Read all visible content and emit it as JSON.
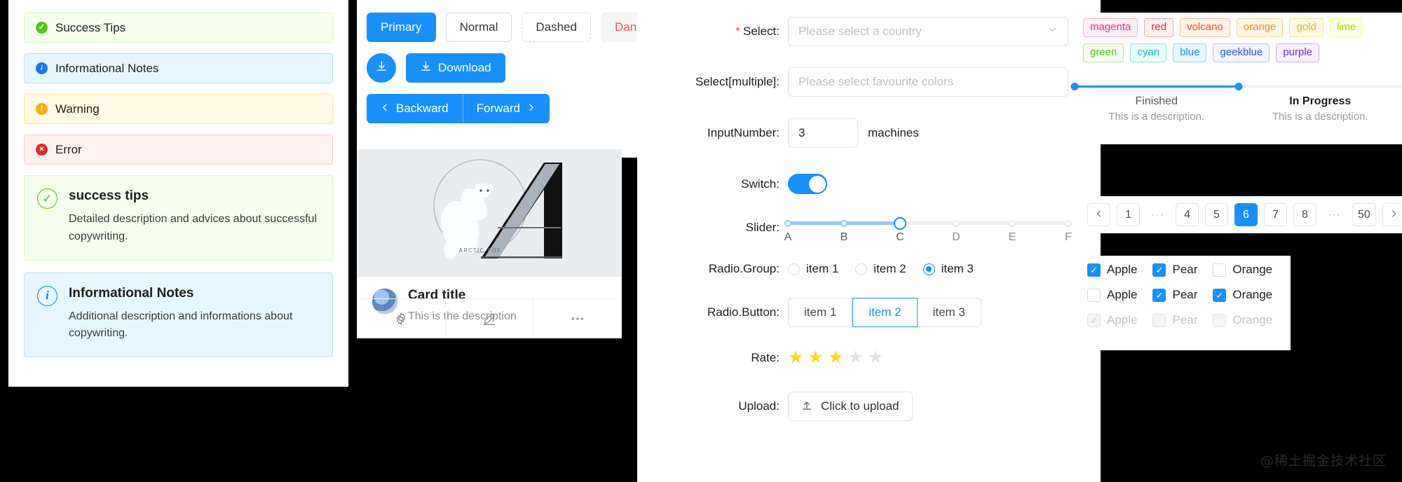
{
  "alerts": {
    "bars": [
      {
        "type": "success",
        "icon": "check-circle-icon",
        "glyph": "✓",
        "text": "Success Tips"
      },
      {
        "type": "info",
        "icon": "info-circle-icon",
        "glyph": "i",
        "text": "Informational Notes"
      },
      {
        "type": "warning",
        "icon": "warning-circle-icon",
        "glyph": "!",
        "text": "Warning"
      },
      {
        "type": "error",
        "icon": "close-circle-icon",
        "glyph": "×",
        "text": "Error"
      }
    ],
    "cards": [
      {
        "type": "success",
        "icon": "check-circle-outline-icon",
        "glyph": "✓",
        "title": "success tips",
        "description": "Detailed description and advices about successful copywriting."
      },
      {
        "type": "info",
        "icon": "info-circle-outline-icon",
        "glyph": "i",
        "title": "Informational Notes",
        "description": "Additional description and informations about copywriting."
      }
    ]
  },
  "buttons": {
    "row1": [
      {
        "label": "Primary",
        "style": "primary"
      },
      {
        "label": "Normal",
        "style": "default"
      },
      {
        "label": "Dashed",
        "style": "dashed"
      },
      {
        "label": "Danger",
        "style": "danger"
      }
    ],
    "download_icon": "download-icon",
    "download_label": "Download",
    "backward_label": "Backward",
    "forward_label": "Forward",
    "backward_icon": "chevron-left-icon",
    "forward_icon": "chevron-right-icon"
  },
  "card": {
    "cover_caption": "ARCTIC FOX",
    "title": "Card title",
    "description": "This is the description",
    "actions": [
      {
        "icon": "gear-icon",
        "glyph": "⚙"
      },
      {
        "icon": "edit-pen-icon",
        "glyph": "✎"
      },
      {
        "icon": "ellipsis-icon",
        "glyph": "⋯"
      }
    ]
  },
  "form": {
    "select": {
      "label": "Select",
      "required_mark": "*",
      "placeholder": "Please select a country",
      "value": "",
      "arrow_icon": "chevron-down-icon"
    },
    "select_multiple": {
      "label": "Select[multiple]",
      "placeholder": "Please select favourite colors",
      "value": ""
    },
    "input_number": {
      "label": "InputNumber",
      "value": "3",
      "unit": "machines"
    },
    "switch": {
      "label": "Switch",
      "checked": true
    },
    "slider": {
      "label": "Slider",
      "marks": [
        "A",
        "B",
        "C",
        "D",
        "E",
        "F"
      ],
      "value": "C",
      "value_index": 2
    },
    "radio_group": {
      "label": "Radio.Group",
      "options": [
        "item 1",
        "item 2",
        "item 3"
      ],
      "selected": "item 3"
    },
    "radio_button": {
      "label": "Radio.Button",
      "options": [
        "item 1",
        "item 2",
        "item 3"
      ],
      "selected": "item 2"
    },
    "rate": {
      "label": "Rate",
      "value": 3,
      "max": 5,
      "glyph": "★"
    },
    "upload": {
      "label": "Upload",
      "button_label": "Click to upload",
      "icon": "upload-icon"
    }
  },
  "tags": {
    "row1": [
      {
        "label": "magenta",
        "color": "#eb2f96",
        "bg": "#fff0f6",
        "border": "#ffadd2"
      },
      {
        "label": "red",
        "color": "#f5222d",
        "bg": "#fff1f0",
        "border": "#ffa39e"
      },
      {
        "label": "volcano",
        "color": "#fa541c",
        "bg": "#fff2e8",
        "border": "#ffbb96"
      },
      {
        "label": "orange",
        "color": "#fa8c16",
        "bg": "#fff7e6",
        "border": "#ffd591"
      },
      {
        "label": "gold",
        "color": "#faad14",
        "bg": "#fffbe6",
        "border": "#ffe58f"
      },
      {
        "label": "lime",
        "color": "#a0d911",
        "bg": "#fcffe6",
        "border": "#eaff8f"
      }
    ],
    "row2": [
      {
        "label": "green",
        "color": "#52c41a",
        "bg": "#f6ffed",
        "border": "#b7eb8f"
      },
      {
        "label": "cyan",
        "color": "#13c2c2",
        "bg": "#e6fffb",
        "border": "#87e8de"
      },
      {
        "label": "blue",
        "color": "#1890ff",
        "bg": "#e6f7ff",
        "border": "#91d5ff"
      },
      {
        "label": "geekblue",
        "color": "#2f54eb",
        "bg": "#f0f5ff",
        "border": "#adc6ff"
      },
      {
        "label": "purple",
        "color": "#722ed1",
        "bg": "#f9f0ff",
        "border": "#d3adf7"
      }
    ]
  },
  "steps": [
    {
      "title": "Finished",
      "description": "This is a description.",
      "status": "finish"
    },
    {
      "title": "In Progress",
      "description": "This is a description.",
      "status": "process"
    }
  ],
  "pagination": {
    "prev_icon": "chevron-left-icon",
    "next_icon": "chevron-right-icon",
    "ellipsis": "···",
    "items": [
      "1",
      "···",
      "4",
      "5",
      "6",
      "7",
      "8",
      "···",
      "50"
    ],
    "current": "6"
  },
  "checkboxes": {
    "rows": [
      [
        {
          "label": "Apple",
          "checked": true,
          "disabled": false
        },
        {
          "label": "Pear",
          "checked": true,
          "disabled": false
        },
        {
          "label": "Orange",
          "checked": false,
          "disabled": false
        }
      ],
      [
        {
          "label": "Apple",
          "checked": false,
          "disabled": false
        },
        {
          "label": "Pear",
          "checked": true,
          "disabled": false
        },
        {
          "label": "Orange",
          "checked": true,
          "disabled": false
        }
      ],
      [
        {
          "label": "Apple",
          "checked": true,
          "disabled": true
        },
        {
          "label": "Pear",
          "checked": false,
          "disabled": true
        },
        {
          "label": "Orange",
          "checked": false,
          "disabled": true
        }
      ]
    ],
    "check_glyph": "✓"
  },
  "watermark": {
    "text": "@稀土掘金技术社区"
  },
  "theme": {
    "primary": "#1890ff",
    "danger": "#ff4d4f",
    "star": "#fadb14"
  }
}
